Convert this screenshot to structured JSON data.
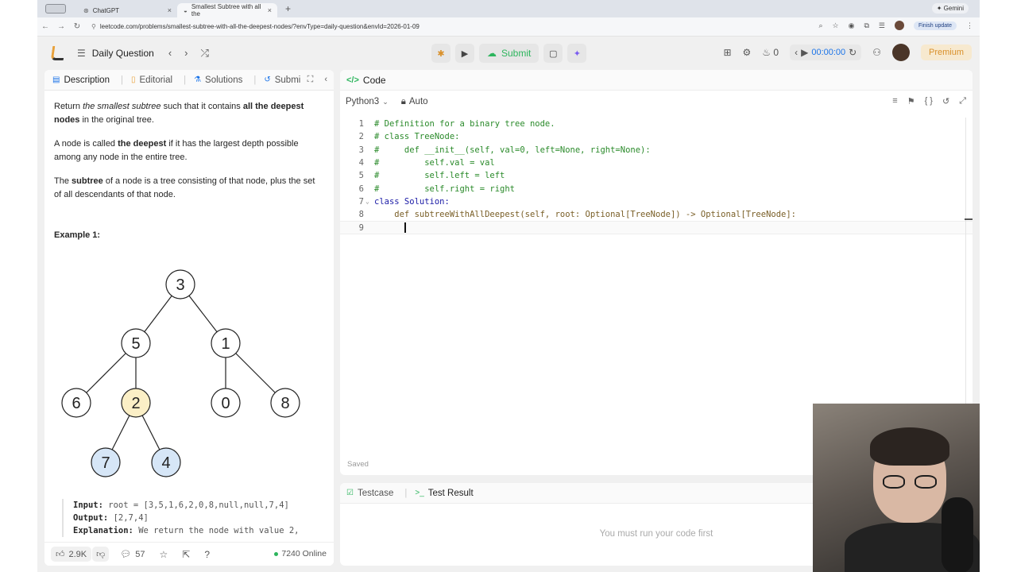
{
  "browser": {
    "tabs": [
      {
        "title": "ChatGPT",
        "icon": "openai-icon"
      },
      {
        "title": "Smallest Subtree with all the",
        "icon": "leetcode-icon"
      }
    ],
    "gemini_label": "Gemini",
    "url": "leetcode.com/problems/smallest-subtree-with-all-the-deepest-nodes/?envType=daily-question&envId=2026-01-09",
    "finish_update": "Finish update"
  },
  "header": {
    "title": "Daily Question",
    "submit_label": "Submit",
    "streak_count": "0",
    "timer": "00:00:00",
    "premium_label": "Premium"
  },
  "left_tabs": [
    {
      "label": "Description"
    },
    {
      "label": "Editorial"
    },
    {
      "label": "Solutions"
    },
    {
      "label": "Submi"
    }
  ],
  "description": {
    "p1": {
      "a": "Return ",
      "b": "the smallest subtree",
      "c": " such that it contains ",
      "d": "all the deepest nodes",
      "e": " in the original tree."
    },
    "p2": {
      "a": "A node is called ",
      "b": "the deepest",
      "c": " if it has the largest depth possible among any node in the entire tree."
    },
    "p3": {
      "a": "The ",
      "b": "subtree",
      "c": " of a node is a tree consisting of that node, plus the set of all descendants of that node."
    },
    "example_title": "Example 1:"
  },
  "tree": {
    "nodes": [
      "3",
      "5",
      "1",
      "6",
      "2",
      "0",
      "8",
      "7",
      "4"
    ],
    "highlight_color": "#fbefc6",
    "deep_color": "#d6e6f7"
  },
  "example": {
    "input_label": "Input:",
    "input_value": "root = [3,5,1,6,2,0,8,null,null,7,4]",
    "output_label": "Output:",
    "output_value": "[2,7,4]",
    "explanation_label": "Explanation:",
    "explanation_value": "We return the node with value 2,"
  },
  "footer": {
    "likes": "2.9K",
    "comments": "57",
    "online": "7240 Online"
  },
  "code_panel": {
    "title": "Code",
    "language": "Python3",
    "mode": "Auto",
    "saved": "Saved",
    "lines": [
      "# Definition for a binary tree node.",
      "# class TreeNode:",
      "#     def __init__(self, val=0, left=None, right=None):",
      "#         self.val = val",
      "#         self.left = left",
      "#         self.right = right",
      "class Solution:",
      "    def subtreeWithAllDeepest(self, root: Optional[TreeNode]) -> Optional[TreeNode]:",
      ""
    ]
  },
  "test_panel": {
    "tab1": "Testcase",
    "tab2": "Test Result",
    "message": "You must run your code first"
  }
}
